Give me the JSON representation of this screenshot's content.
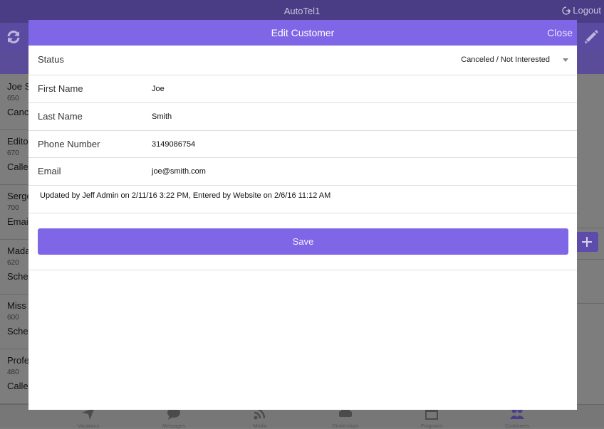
{
  "app": {
    "title": "AutoTel1",
    "logout_label": "Logout"
  },
  "customers": [
    {
      "name": "Joe Smith",
      "code": "650",
      "status": "Canceled / Not Interested"
    },
    {
      "name": "Editor",
      "code": "670",
      "status": "Called"
    },
    {
      "name": "Sergei",
      "code": "700",
      "status": "Emailed"
    },
    {
      "name": "Madame",
      "code": "620",
      "status": "Scheduled"
    },
    {
      "name": "Miss",
      "code": "600",
      "status": "Scheduled"
    },
    {
      "name": "Professor",
      "code": "480",
      "status": "Called"
    }
  ],
  "tabs": [
    {
      "label": "Vacations",
      "icon": "send-icon"
    },
    {
      "label": "Messages",
      "icon": "chat-icon"
    },
    {
      "label": "Media",
      "icon": "rss-icon"
    },
    {
      "label": "Dealerships",
      "icon": "car-icon"
    },
    {
      "label": "Programs",
      "icon": "calendar-icon"
    },
    {
      "label": "Customers",
      "icon": "people-icon"
    }
  ],
  "modal": {
    "title": "Edit Customer",
    "close_label": "Close",
    "status": {
      "label": "Status",
      "value": "Canceled / Not Interested"
    },
    "fields": {
      "first_name": {
        "label": "First Name",
        "value": "Joe"
      },
      "last_name": {
        "label": "Last Name",
        "value": "Smith"
      },
      "phone": {
        "label": "Phone Number",
        "value": "3149086754"
      },
      "email": {
        "label": "Email",
        "value": "joe@smith.com"
      }
    },
    "meta": "Updated by Jeff Admin on 2/11/16 3:22 PM, Entered by Website on 2/6/16 11:12 AM",
    "save_label": "Save"
  },
  "colors": {
    "accent": "#7e66e6",
    "topbar": "#4a3d86",
    "overlay": "#7c7c7c"
  }
}
